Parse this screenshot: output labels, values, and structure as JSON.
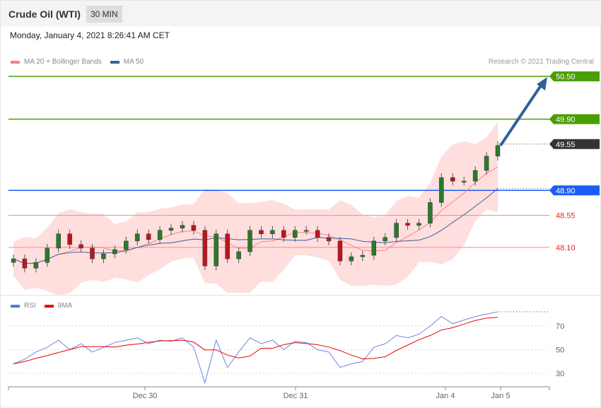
{
  "header": {
    "title": "Crude Oil (WTI)",
    "timeframe": "30 MIN",
    "datetime": "Monday, January 4, 2021 8:26:41 AM CET"
  },
  "legend": {
    "ma20": "MA 20 + Bollinger Bands",
    "ma50": "MA 50",
    "rsi": "RSI",
    "ma9": "9MA",
    "credit": "Research © 2021 Trading Central"
  },
  "colors": {
    "green": "#4a9e00",
    "blue": "#1a5ef5",
    "dark": "#333333",
    "red": "#ee2222",
    "ma50": "#3a5fa0",
    "band": "#ffd6d6"
  },
  "chart_data": {
    "type": "candlestick",
    "levels": [
      {
        "label": "50.50",
        "value": 50.5,
        "style": "green"
      },
      {
        "label": "49.90",
        "value": 49.9,
        "style": "green"
      },
      {
        "label": "49.55",
        "value": 49.55,
        "style": "dark"
      },
      {
        "label": "48.90",
        "value": 48.9,
        "style": "blue"
      },
      {
        "label": "48.55",
        "value": 48.55,
        "style": "red"
      },
      {
        "label": "48.10",
        "value": 48.1,
        "style": "red"
      }
    ],
    "closes": [
      47.94,
      47.81,
      47.89,
      48.09,
      48.29,
      48.14,
      48.09,
      47.94,
      48.01,
      48.07,
      48.19,
      48.29,
      48.21,
      48.34,
      48.37,
      48.41,
      48.34,
      47.84,
      48.29,
      47.94,
      48.04,
      48.34,
      48.29,
      48.34,
      48.24,
      48.34,
      48.34,
      48.24,
      48.19,
      47.91,
      47.97,
      47.99,
      48.19,
      48.24,
      48.44,
      48.41,
      48.44,
      48.73,
      49.08,
      49.03,
      49.03,
      49.18,
      49.38,
      49.53
    ],
    "rsi": [
      38,
      42,
      48,
      52,
      58,
      50,
      55,
      48,
      52,
      56,
      58,
      60,
      55,
      58,
      57,
      60,
      52,
      22,
      58,
      35,
      48,
      60,
      55,
      58,
      50,
      57,
      56,
      50,
      48,
      35,
      38,
      40,
      52,
      55,
      62,
      60,
      63,
      70,
      78,
      72,
      75,
      78,
      80,
      82
    ],
    "rsi_ticks": [
      70,
      50,
      30
    ],
    "x_labels": [
      "Dec 30",
      "Dec 31",
      "Jan 4",
      "Jan 5"
    ],
    "target": 50.5
  }
}
